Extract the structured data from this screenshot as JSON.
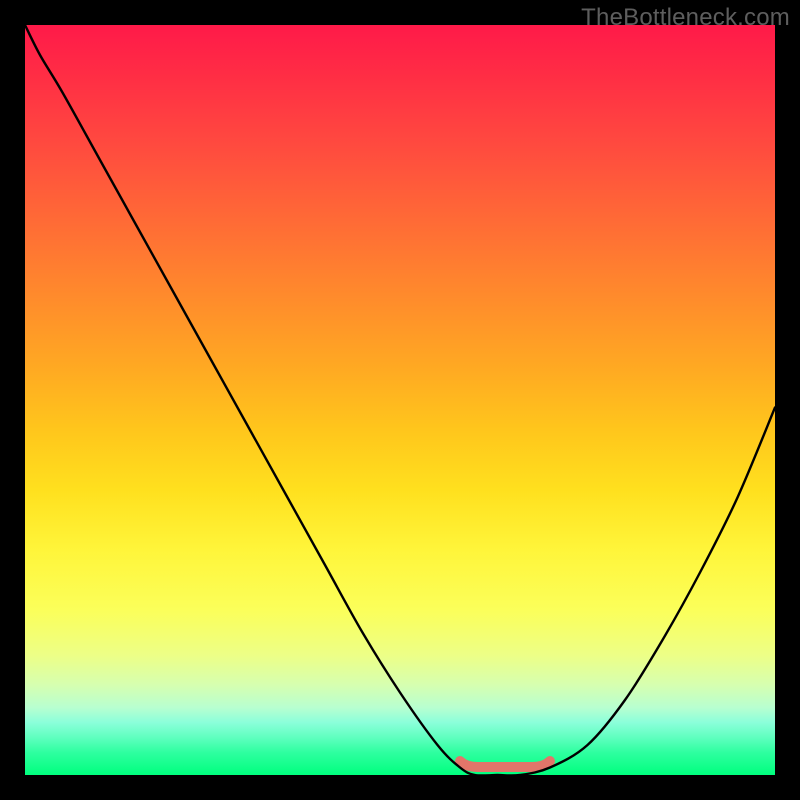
{
  "watermark": "TheBottleneck.com",
  "colors": {
    "background": "#000000",
    "curve": "#000000",
    "flat_highlight": "#e2756a"
  },
  "chart_data": {
    "type": "line",
    "title": "",
    "xlabel": "",
    "ylabel": "",
    "xlim": [
      0,
      100
    ],
    "ylim": [
      0,
      100
    ],
    "x": [
      0,
      2,
      5,
      10,
      15,
      20,
      25,
      30,
      35,
      40,
      45,
      50,
      55,
      58,
      60,
      63,
      66,
      70,
      75,
      80,
      85,
      90,
      95,
      100
    ],
    "values": [
      100,
      96,
      91,
      82,
      73,
      64,
      55,
      46,
      37,
      28,
      19,
      11,
      4,
      1,
      0,
      0,
      0,
      1,
      4,
      10,
      18,
      27,
      37,
      49
    ],
    "flat_region_x": [
      58,
      70
    ],
    "notes": "Gradient background red→yellow→green top→bottom. Black V-shaped bottleneck curve; coral horizontal segment marks the flat minimum (~x 58–70)."
  }
}
